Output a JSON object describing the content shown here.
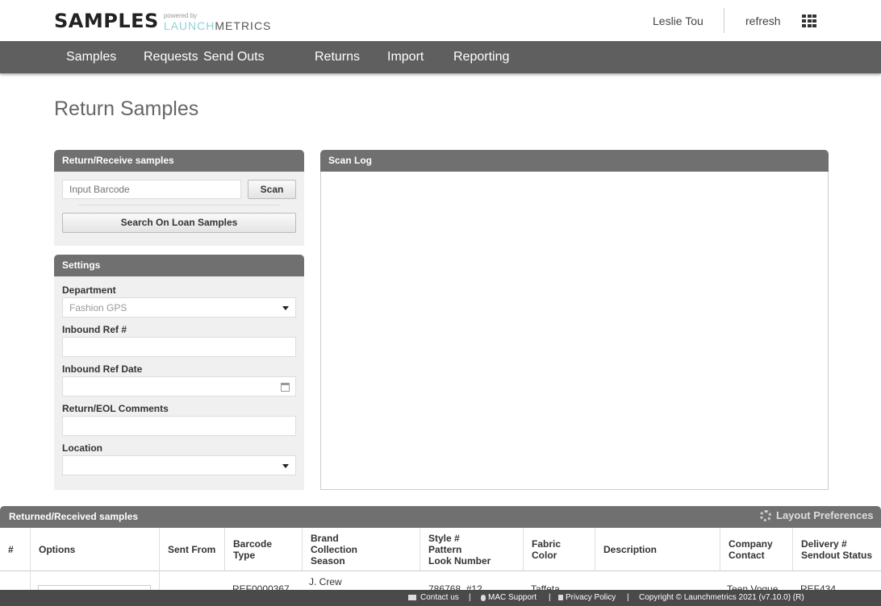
{
  "header": {
    "logo_main": "SAMPLES",
    "logo_powered": "powered by",
    "logo_brand_accent": "LAUNCH",
    "logo_brand_rest": "METRICS",
    "user_name": "Leslie Tou",
    "refresh_label": "refresh",
    "apps_icon": "apps-grid-icon"
  },
  "nav": {
    "items": [
      "Samples",
      "Requests",
      "Send Outs",
      "Returns",
      "Import",
      "Reporting"
    ]
  },
  "page": {
    "title": "Return Samples"
  },
  "return_panel": {
    "title": "Return/Receive samples",
    "barcode_placeholder": "Input Barcode",
    "scan_label": "Scan",
    "search_label": "Search On Loan Samples"
  },
  "settings": {
    "title": "Settings",
    "department_label": "Department",
    "department_value": "Fashion GPS",
    "inbound_ref_label": "Inbound Ref #",
    "inbound_ref_value": "",
    "inbound_ref_date_label": "Inbound Ref Date",
    "inbound_ref_date_value": "",
    "comments_label": "Return/EOL Comments",
    "comments_value": "",
    "location_label": "Location",
    "location_value": ""
  },
  "scan_log": {
    "title": "Scan Log"
  },
  "grid": {
    "title": "Returned/Received samples",
    "layout_pref_label": "Layout Preferences",
    "columns": [
      "#",
      "Options",
      "Sent From",
      "Barcode\nType",
      "Brand\nCollection\nSeason",
      "Style #\nPattern\nLook Number",
      "Fabric\nColor",
      "Description",
      "Company\nContact",
      "Delivery #\nSendout Status"
    ],
    "rows": [
      {
        "barcode": "REF0000367",
        "brand": "J. Crew",
        "style": "786768, #12",
        "fabric": "Taffeta",
        "company": "Teen Vogue",
        "delivery": "REF434"
      }
    ]
  },
  "footer": {
    "contact": "Contact us",
    "mac_support": "MAC Support",
    "privacy": "Privacy Policy",
    "copyright": "Copyright © Launchmetrics 2021 (v7.10.0) (R)",
    "separator": "|"
  }
}
